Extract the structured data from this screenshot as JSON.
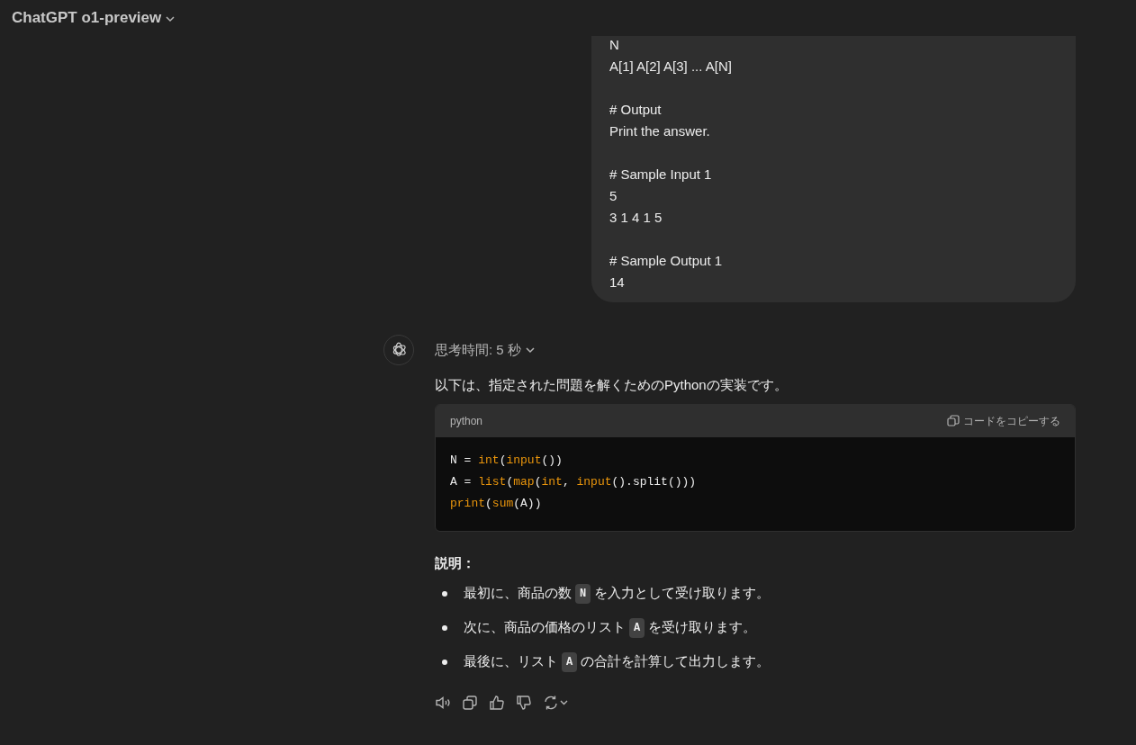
{
  "header": {
    "title": "ChatGPT o1-preview"
  },
  "user_message": {
    "paragraphs": [
      [
        "N",
        "A[1] A[2] A[3] ... A[N]"
      ],
      [
        "# Output",
        "Print the answer."
      ],
      [
        "# Sample Input 1",
        "5",
        "3 1 4 1 5"
      ],
      [
        "# Sample Output 1",
        "14"
      ]
    ]
  },
  "assistant": {
    "thinking": "思考時間: 5 秒",
    "expanded": false,
    "intro": "以下は、指定された問題を解くためのPythonの実装です。",
    "code_block": {
      "language": "python",
      "copy_label": "コードをコピーする",
      "lines": [
        [
          {
            "text": "N = ",
            "kind": "plain"
          },
          {
            "text": "int",
            "kind": "builtin"
          },
          {
            "text": "(",
            "kind": "plain"
          },
          {
            "text": "input",
            "kind": "builtin"
          },
          {
            "text": "())",
            "kind": "plain"
          }
        ],
        [
          {
            "text": "A = ",
            "kind": "plain"
          },
          {
            "text": "list",
            "kind": "builtin"
          },
          {
            "text": "(",
            "kind": "plain"
          },
          {
            "text": "map",
            "kind": "builtin"
          },
          {
            "text": "(",
            "kind": "plain"
          },
          {
            "text": "int",
            "kind": "builtin"
          },
          {
            "text": ", ",
            "kind": "plain"
          },
          {
            "text": "input",
            "kind": "builtin"
          },
          {
            "text": "().split()))",
            "kind": "plain"
          }
        ],
        [
          {
            "text": "print",
            "kind": "builtin"
          },
          {
            "text": "(",
            "kind": "plain"
          },
          {
            "text": "sum",
            "kind": "builtin"
          },
          {
            "text": "(A))",
            "kind": "plain"
          }
        ]
      ]
    },
    "heading": "説明：",
    "bullets": [
      [
        {
          "text": "最初に、商品の数",
          "kind": "text"
        },
        {
          "text": "N",
          "kind": "code"
        },
        {
          "text": "を入力として受け取ります。",
          "kind": "text"
        }
      ],
      [
        {
          "text": "次に、商品の価格のリスト",
          "kind": "text"
        },
        {
          "text": "A",
          "kind": "code"
        },
        {
          "text": "を受け取ります。",
          "kind": "text"
        }
      ],
      [
        {
          "text": "最後に、リスト",
          "kind": "text"
        },
        {
          "text": "A",
          "kind": "code"
        },
        {
          "text": "の合計を計算して出力します。",
          "kind": "text"
        }
      ]
    ]
  }
}
